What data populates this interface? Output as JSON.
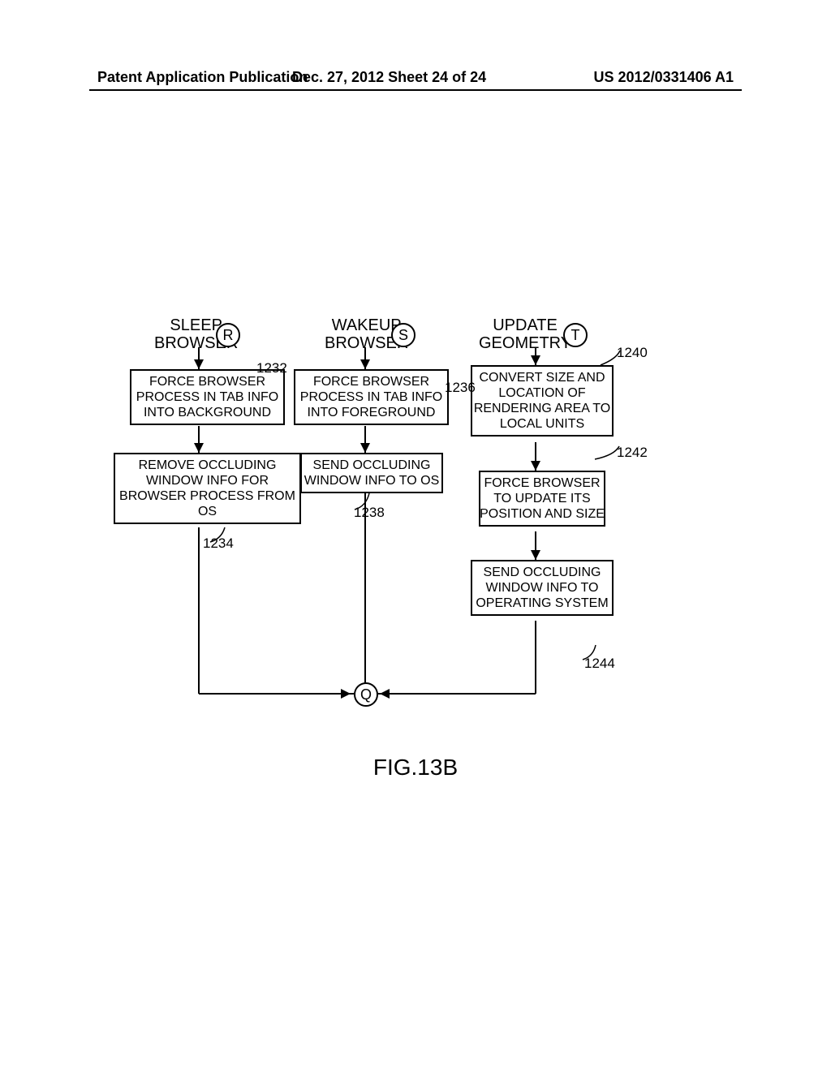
{
  "header": {
    "left": "Patent Application Publication",
    "mid": "Dec. 27, 2012  Sheet 24 of 24",
    "right": "US 2012/0331406 A1"
  },
  "figure_label": "FIG.13B",
  "columns": {
    "c1": {
      "title": "SLEEP\nBROWSER",
      "letter": "R"
    },
    "c2": {
      "title": "WAKEUP\nBROWSER",
      "letter": "S"
    },
    "c3": {
      "title": "UPDATE\nGEOMETRY",
      "letter": "T"
    }
  },
  "endpoint": {
    "letter": "Q"
  },
  "boxes": {
    "b1232": "FORCE BROWSER\nPROCESS IN TAB INFO\nINTO BACKGROUND",
    "b1234": "REMOVE OCCLUDING\nWINDOW INFO FOR\nBROWSER PROCESS FROM\nOS",
    "b1236": "FORCE BROWSER\nPROCESS IN TAB INFO\nINTO FOREGROUND",
    "b1238": "SEND OCCLUDING\nWINDOW INFO TO OS",
    "b1240": "CONVERT SIZE AND\nLOCATION OF\nRENDERING AREA TO\nLOCAL UNITS",
    "b1242": "FORCE BROWSER\nTO UPDATE ITS\nPOSITION AND SIZE",
    "b1244": "SEND OCCLUDING\nWINDOW INFO TO\nOPERATING SYSTEM"
  },
  "refs": {
    "r1232": "1232",
    "r1234": "1234",
    "r1236": "1236",
    "r1238": "1238",
    "r1240": "1240",
    "r1242": "1242",
    "r1244": "1244"
  }
}
